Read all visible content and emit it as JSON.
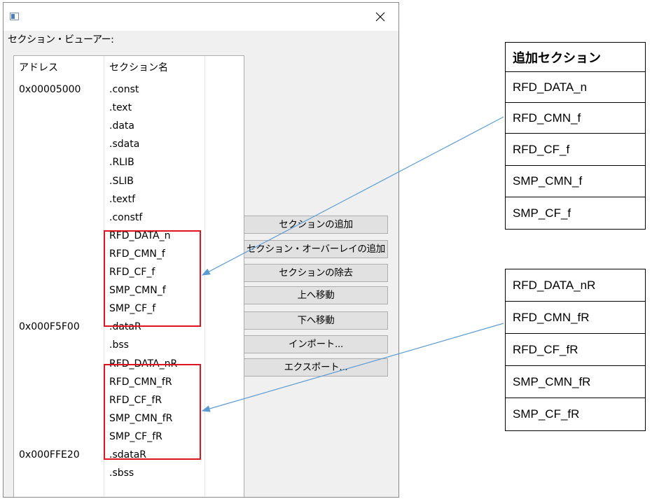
{
  "window": {
    "close_glyph": "×"
  },
  "viewer": {
    "group_label": "セクション・ビューアー:",
    "columns": {
      "address": "アドレス",
      "section_name": "セクション名"
    },
    "rows": [
      {
        "address": "0x00005000",
        "name": ".const"
      },
      {
        "address": "",
        "name": ".text"
      },
      {
        "address": "",
        "name": ".data"
      },
      {
        "address": "",
        "name": ".sdata"
      },
      {
        "address": "",
        "name": ".RLIB"
      },
      {
        "address": "",
        "name": ".SLIB"
      },
      {
        "address": "",
        "name": ".textf"
      },
      {
        "address": "",
        "name": ".constf"
      },
      {
        "address": "",
        "name": "RFD_DATA_n"
      },
      {
        "address": "",
        "name": "RFD_CMN_f"
      },
      {
        "address": "",
        "name": "RFD_CF_f"
      },
      {
        "address": "",
        "name": "SMP_CMN_f"
      },
      {
        "address": "",
        "name": "SMP_CF_f"
      },
      {
        "address": "0x000F5F00",
        "name": ".dataR"
      },
      {
        "address": "",
        "name": ".bss"
      },
      {
        "address": "",
        "name": "RFD_DATA_nR"
      },
      {
        "address": "",
        "name": "RFD_CMN_fR"
      },
      {
        "address": "",
        "name": "RFD_CF_fR"
      },
      {
        "address": "",
        "name": "SMP_CMN_fR"
      },
      {
        "address": "",
        "name": "SMP_CF_fR"
      },
      {
        "address": "0x000FFE20",
        "name": ".sdataR"
      },
      {
        "address": "",
        "name": ".sbss"
      }
    ]
  },
  "buttons": {
    "add_section": "セクションの追加",
    "add_overlay": "セクション・オーバーレイの追加",
    "remove_section": "セクションの除去",
    "move_up": "上へ移動",
    "move_down": "下へ移動",
    "import": "インポート...",
    "export": "エクスポート..."
  },
  "annotation_table_1": {
    "header": "追加セクション",
    "rows": [
      "RFD_DATA_n",
      "RFD_CMN_f",
      "RFD_CF_f",
      "SMP_CMN_f",
      "SMP_CF_f"
    ]
  },
  "annotation_table_2": {
    "rows": [
      "RFD_DATA_nR",
      "RFD_CMN_fR",
      "RFD_CF_fR",
      "SMP_CMN_fR",
      "SMP_CF_fR"
    ]
  },
  "colors": {
    "highlight_box": "#e0141e",
    "arrow": "#5b9bd5"
  }
}
